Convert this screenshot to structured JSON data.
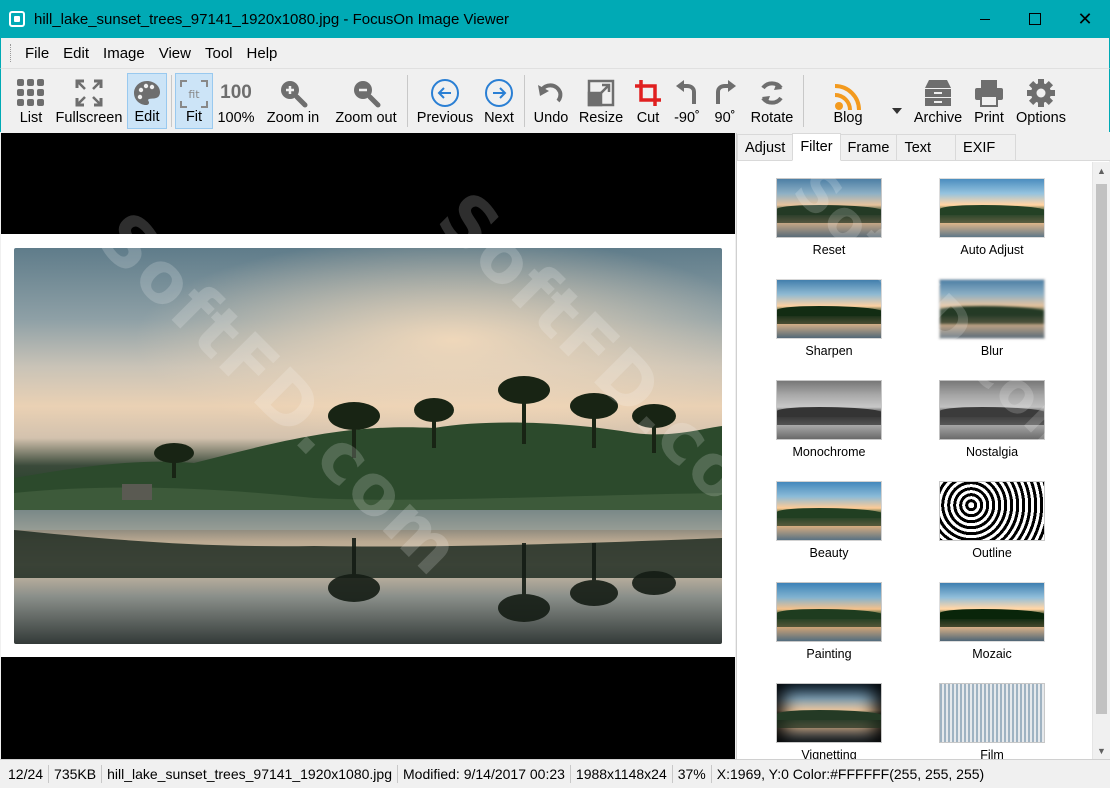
{
  "window": {
    "title": "hill_lake_sunset_trees_97141_1920x1080.jpg - FocusOn Image Viewer",
    "minimize": "—",
    "maximize": "☐",
    "close": "✕"
  },
  "menu": [
    "File",
    "Edit",
    "Image",
    "View",
    "Tool",
    "Help"
  ],
  "toolbar": {
    "list": "List",
    "fullscreen": "Fullscreen",
    "edit": "Edit",
    "fit": "Fit",
    "fit_icon_text": "fit",
    "hundred": "100%",
    "hundred_icon_text": "100",
    "zoom_in": "Zoom in",
    "zoom_out": "Zoom out",
    "previous": "Previous",
    "next": "Next",
    "undo": "Undo",
    "resize": "Resize",
    "cut": "Cut",
    "rot_left": "-90˚",
    "rot_right": "90˚",
    "rotate": "Rotate",
    "blog": "Blog",
    "archive": "Archive",
    "print": "Print",
    "options": "Options"
  },
  "panel": {
    "tabs": [
      "Adjust",
      "Filter",
      "Frame",
      "Text",
      "EXIF"
    ],
    "active_tab": "Filter",
    "filters": [
      "Reset",
      "Auto Adjust",
      "Sharpen",
      "Blur",
      "Monochrome",
      "Nostalgia",
      "Beauty",
      "Outline",
      "Painting",
      "Mozaic",
      "Vignetting",
      "Film"
    ]
  },
  "status": {
    "position": "12/24",
    "size": "735KB",
    "filename": "hill_lake_sunset_trees_97141_1920x1080.jpg",
    "modified": "Modified: 9/14/2017 00:23",
    "dimensions": "1988x1148x24",
    "zoom": "37%",
    "pixel": "X:1969, Y:0 Color:#FFFFFF(255, 255, 255)"
  },
  "watermark": "SoftFD.com",
  "colors": {
    "titlebar": "#00aab5",
    "accent_blue": "#2a7fd4",
    "cut_red": "#e02020",
    "blog_orange": "#f39a1e"
  }
}
